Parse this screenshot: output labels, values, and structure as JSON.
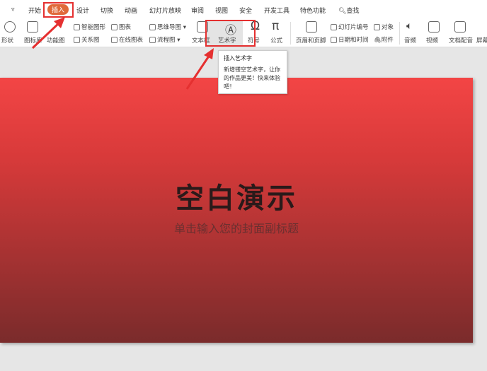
{
  "tabs": [
    "开始",
    "插入",
    "设计",
    "切换",
    "动画",
    "幻灯片放映",
    "审阅",
    "视图",
    "安全",
    "开发工具",
    "特色功能",
    "查找"
  ],
  "ribbon": {
    "shape": "形状",
    "icon_lib": "图标库",
    "func_chart": "功能图",
    "smart_art": "智能图形",
    "chart": "图表",
    "relation": "关系图",
    "online_chart": "在线图表",
    "mindmap": "思维导图",
    "flowchart": "流程图",
    "textbox": "文本框",
    "wordart": "艺术字",
    "symbol": "符号",
    "formula": "公式",
    "header_footer": "页眉和页脚",
    "slide_number": "幻灯片编号",
    "object": "对象",
    "datetime": "日期和时间",
    "attachment": "附件",
    "audio": "音频",
    "video": "视频",
    "doc_voice": "文档配音",
    "screen": "屏幕"
  },
  "tooltip": {
    "title": "插入艺术字",
    "body": "新增镂空艺术字，让你的作品更美！快来体验吧！"
  },
  "slide": {
    "title": "空白演示",
    "subtitle": "单击输入您的封面副标题"
  },
  "colors": {
    "accent": "#e0693a",
    "annotation": "#e53030"
  }
}
